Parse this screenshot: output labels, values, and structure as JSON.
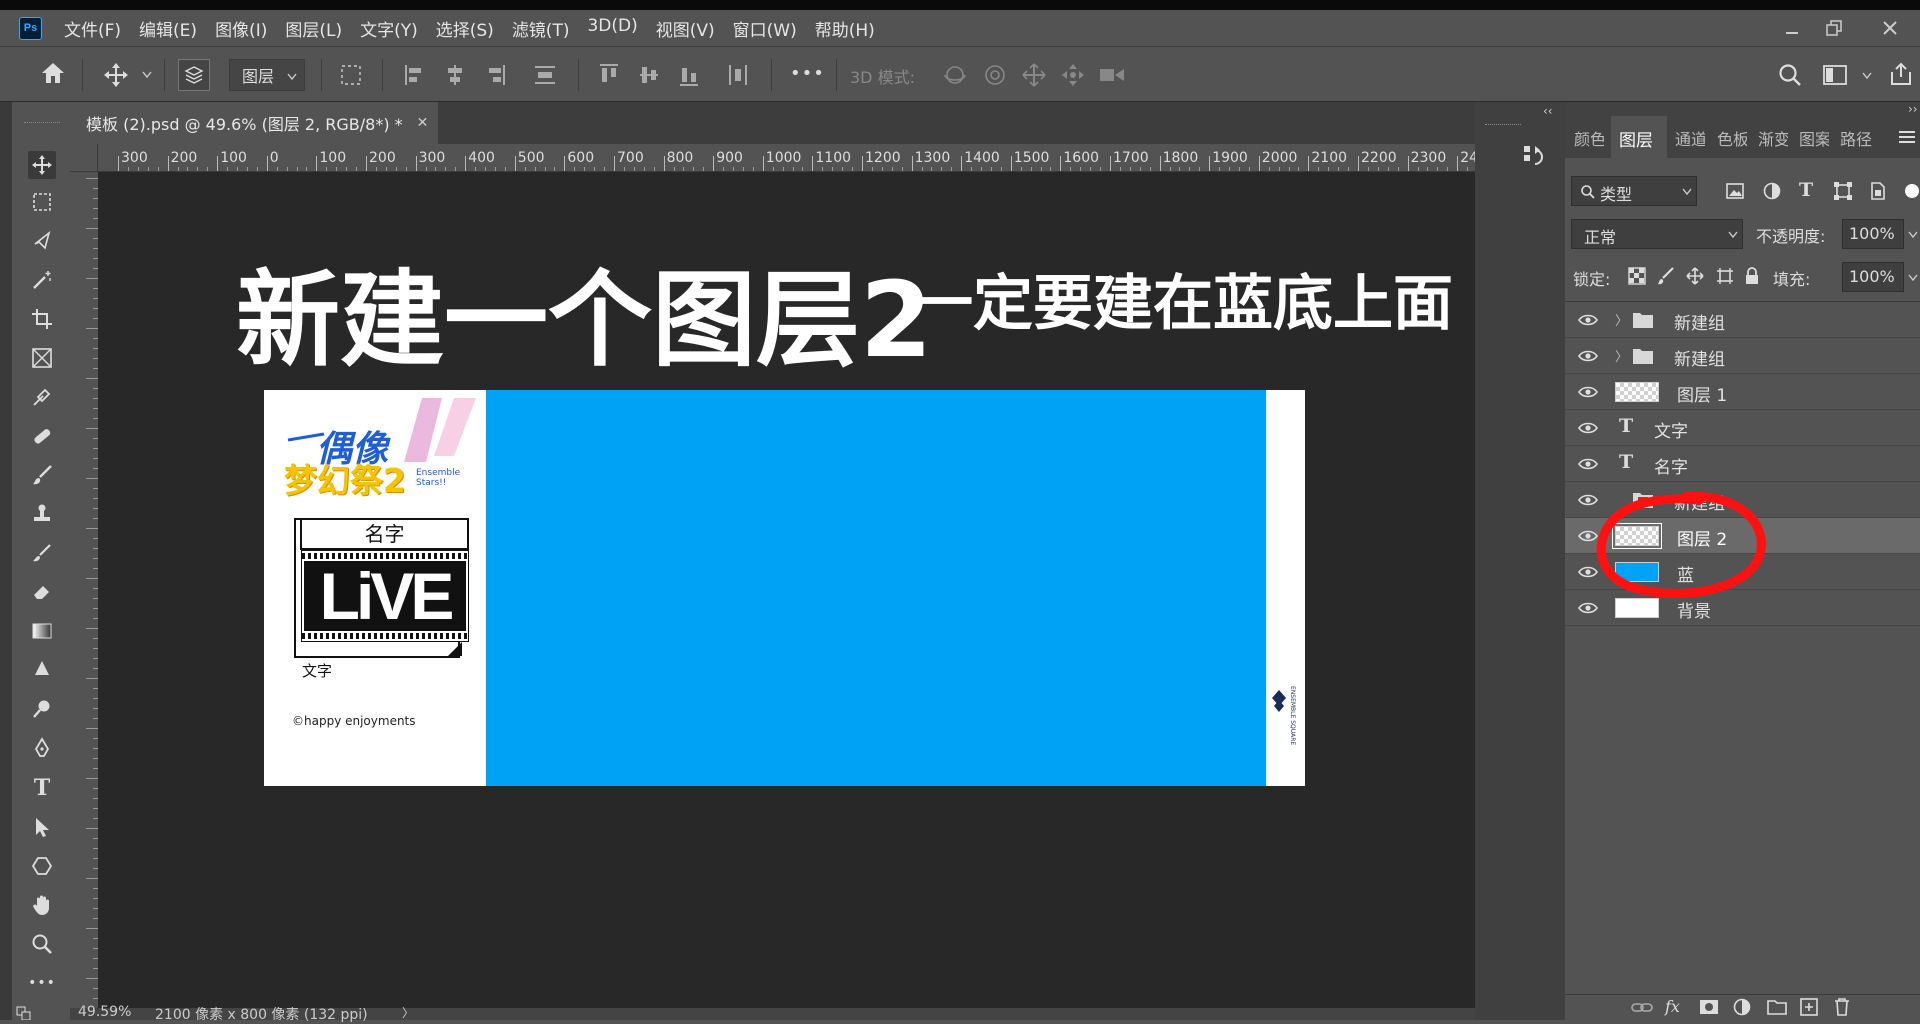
{
  "menu": {
    "logo": "Ps",
    "items": [
      "文件(F)",
      "编辑(E)",
      "图像(I)",
      "图层(L)",
      "文字(Y)",
      "选择(S)",
      "滤镜(T)",
      "3D(D)",
      "视图(V)",
      "窗口(W)",
      "帮助(H)"
    ]
  },
  "options": {
    "target_select": "图层",
    "mode_3d_label": "3D 模式:",
    "more": "•••"
  },
  "document": {
    "tab_title": "模板 (2).psd @ 49.6% (图层 2, RGB/8*) *",
    "ruler_h_labels": [
      "300",
      "200",
      "100",
      "0",
      "100",
      "200",
      "300",
      "400",
      "500",
      "600",
      "700",
      "800",
      "900",
      "1000",
      "1100",
      "1200",
      "1300",
      "1400",
      "1500",
      "1600",
      "1700",
      "1800",
      "1900",
      "2000",
      "2100",
      "2200",
      "2300",
      "24"
    ],
    "status_zoom": "49.59%",
    "status_info": "2100 像素 x 800 像素 (132 ppi)",
    "status_arrow": "〉"
  },
  "annotation": {
    "main": "新建一个图层2",
    "sub": "一定要建在蓝底上面"
  },
  "artwork": {
    "logo_line1": "偶像",
    "logo_line2": "梦幻祭2",
    "logo_small": "Ensemble Stars!!",
    "name_label": "名字",
    "live_text": "LiVE",
    "text_label": "文字",
    "copyright": "©happy enjoyments",
    "side_logo": "ENSEMBLE SQUARE",
    "colors": {
      "blue": "#00a2f5",
      "logo_blue": "#1f5ed8",
      "logo_yellow": "#f2c500",
      "annotation_red": "#ff1111"
    }
  },
  "panel": {
    "tabs": [
      "颜色",
      "图层",
      "通道",
      "色板",
      "渐变",
      "图案",
      "路径"
    ],
    "active_tab": "图层",
    "filter_kind": "类型",
    "blend_mode": "正常",
    "opacity_label": "不透明度:",
    "opacity_value": "100%",
    "lock_label": "锁定:",
    "fill_label": "填充:",
    "fill_value": "100%",
    "layers": [
      {
        "name": "新建组",
        "kind": "group",
        "selected": false
      },
      {
        "name": "新建组",
        "kind": "group",
        "selected": false
      },
      {
        "name": "图层 1",
        "kind": "pixel",
        "selected": false
      },
      {
        "name": "文字",
        "kind": "text",
        "selected": false
      },
      {
        "name": "名字",
        "kind": "text",
        "selected": false
      },
      {
        "name": "新建组",
        "kind": "group",
        "selected": false
      },
      {
        "name": "图层 2",
        "kind": "pixel",
        "selected": true
      },
      {
        "name": "蓝",
        "kind": "pixel",
        "selected": false
      },
      {
        "name": "背景",
        "kind": "pixel",
        "selected": false
      }
    ]
  }
}
